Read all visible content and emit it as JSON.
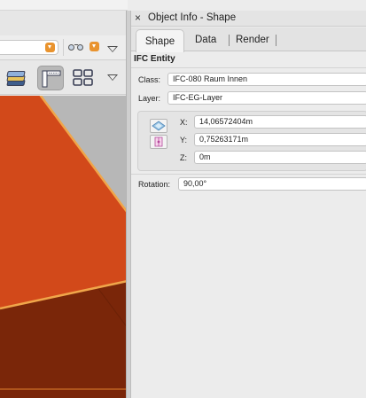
{
  "palette": {
    "title": "Object Info - Shape",
    "close_glyph": "×",
    "tabs": [
      {
        "label": "Shape",
        "active": true
      },
      {
        "label": "Data",
        "active": false
      },
      {
        "label": "Render",
        "active": false
      }
    ],
    "section_title": "IFC Entity",
    "class": {
      "label": "Class:",
      "value": "IFC-080 Raum Innen"
    },
    "layer": {
      "label": "Layer:",
      "value": "IFC-EG-Layer"
    },
    "x": {
      "label": "X:",
      "value": "14,06572404m"
    },
    "y": {
      "label": "Y:",
      "value": "0,75263171m"
    },
    "z": {
      "label": "Z:",
      "value": "0m"
    },
    "rotation": {
      "label": "Rotation:",
      "value": "90,00°"
    }
  },
  "toolbar": {
    "icons": [
      "class-popup-arrow",
      "visibility-glasses-icon",
      "visibility-arrow",
      "layers-icon",
      "standard-view-icon",
      "view-grid-icon",
      "toolbar-menu-triangle"
    ]
  },
  "colors": {
    "accent_orange": "#e9932e",
    "object_face": "#d2491a",
    "object_dark": "#7a2609",
    "object_edge": "#f0a64a"
  }
}
